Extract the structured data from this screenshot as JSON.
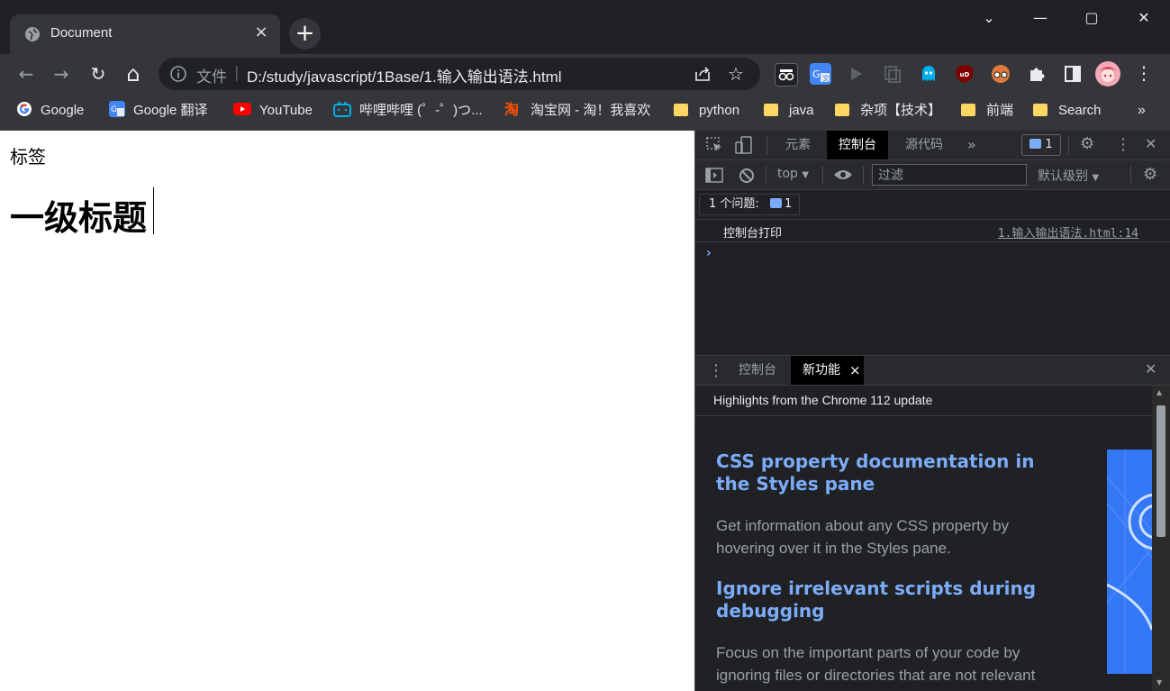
{
  "browser": {
    "tab": {
      "title": "Document",
      "close": "×"
    },
    "new_tab": "+",
    "window_controls": {
      "dropdown": "⌄",
      "minimize": "—",
      "maximize": "▢",
      "close": "✕"
    },
    "nav": {
      "back": "←",
      "forward": "→",
      "reload": "↻",
      "home": "⌂"
    },
    "omnibox": {
      "scheme_label": "文件",
      "separator": "|",
      "url": "D:/study/javascript/1Base/1.输入输出语法.html"
    },
    "extensions": [
      {
        "name": "extension-incognito-icon",
        "color": "#ffffff"
      },
      {
        "name": "extension-translate-icon",
        "color": "#4285f4"
      },
      {
        "name": "extension-play-icon",
        "color": "#5f6368"
      },
      {
        "name": "extension-copy-icon",
        "color": "#5f6368"
      },
      {
        "name": "extension-ghostery-icon",
        "color": "#00aef0"
      },
      {
        "name": "extension-ublock-icon",
        "color": "#800000"
      },
      {
        "name": "extension-glasses-icon",
        "color": "#e07a3a"
      }
    ],
    "bookmarks": [
      {
        "label": "Google",
        "icon": "google-icon"
      },
      {
        "label": "Google 翻译",
        "icon": "translate-icon"
      },
      {
        "label": "YouTube",
        "icon": "youtube-icon"
      },
      {
        "label": "哔哩哔哩 (゜-゜)つ...",
        "icon": "bilibili-icon"
      },
      {
        "label": "淘宝网 - 淘！我喜欢",
        "icon": "taobao-icon"
      },
      {
        "label": "python",
        "icon": "folder-icon"
      },
      {
        "label": "java",
        "icon": "folder-icon"
      },
      {
        "label": "杂项【技术】",
        "icon": "folder-icon"
      },
      {
        "label": "前端",
        "icon": "folder-icon"
      },
      {
        "label": "Search",
        "icon": "folder-icon"
      }
    ],
    "bookmarks_overflow": "»",
    "taobao_glyph": "淘"
  },
  "page": {
    "label": "标签",
    "heading": "一级标题"
  },
  "devtools": {
    "tabs": [
      "元素",
      "控制台",
      "源代码"
    ],
    "more_tabs": "»",
    "issues_count": "1",
    "console": {
      "context": "top",
      "filter_placeholder": "过滤",
      "level": "默认级别",
      "issues_label": "1 个问题:",
      "issues_count": "1",
      "log_message": "控制台打印",
      "log_source": "1.输入输出语法.html:14",
      "prompt": "›"
    },
    "drawer": {
      "tabs": [
        "控制台",
        "新功能"
      ],
      "tab_close": "×",
      "whatsnew_title": "Highlights from the Chrome 112 update",
      "items": [
        {
          "heading": "CSS property documentation in the Styles pane",
          "body": "Get information about any CSS property by hovering over it in the Styles pane."
        },
        {
          "heading": "Ignore irrelevant scripts during debugging",
          "body": "Focus on the important parts of your code by ignoring files or directories that are not relevant"
        }
      ]
    }
  }
}
